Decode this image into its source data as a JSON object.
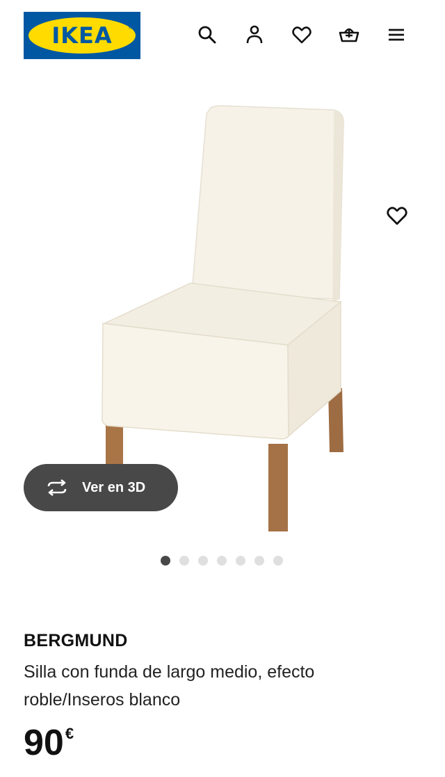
{
  "header": {
    "logo_text": "IKEA",
    "logo_registered": "®",
    "icons": [
      "search-icon",
      "account-icon",
      "heart-icon",
      "basket-icon",
      "menu-icon"
    ]
  },
  "gallery": {
    "image_subject": "white chair",
    "wishlist_icon": "heart-icon",
    "view3d_label": "Ver en 3D",
    "view3d_icon": "rotate-icon",
    "slide_count": 7,
    "active_slide": 1
  },
  "product": {
    "name": "BERGMUND",
    "description": "Silla con funda de largo medio, efecto roble/Inseros blanco",
    "price_integer": "90",
    "price_currency": "€"
  },
  "colors": {
    "ikea_blue": "#0058a3",
    "ikea_yellow": "#ffdb00",
    "button_dark": "#484848",
    "dot_inactive": "#dfdfdf"
  }
}
